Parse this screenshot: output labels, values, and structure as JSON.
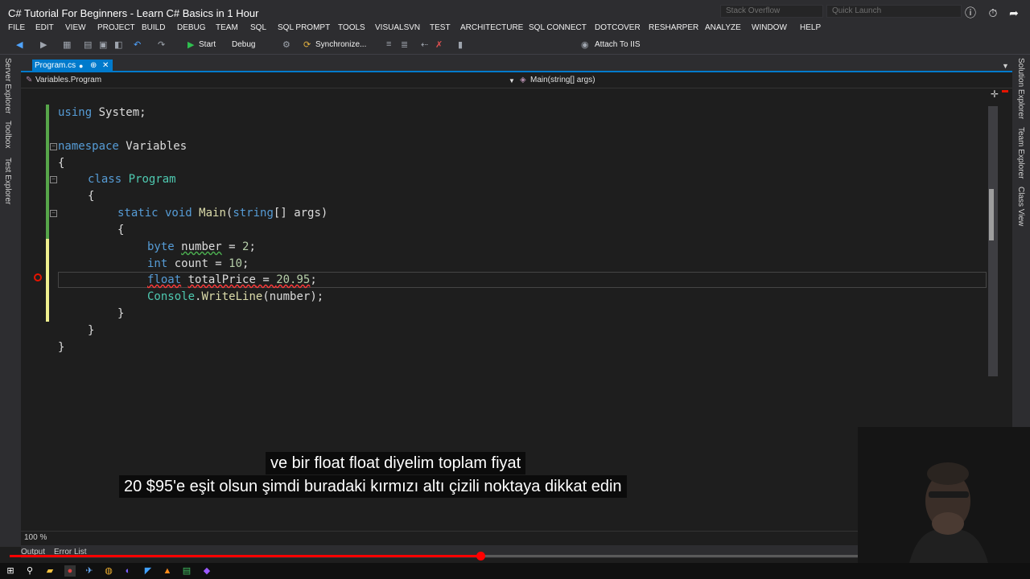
{
  "video_title": "C# Tutorial For Beginners - Learn C# Basics in 1 Hour",
  "search": {
    "stack_overflow": "Stack Overflow",
    "quick_launch": "Quick Launch"
  },
  "menu": [
    "FILE",
    "EDIT",
    "VIEW",
    "PROJECT",
    "BUILD",
    "DEBUG",
    "TEAM",
    "SQL",
    "SQL PROMPT",
    "TOOLS",
    "VISUALSVN",
    "TEST",
    "ARCHITECTURE",
    "SQL CONNECT",
    "DOTCOVER",
    "RESHARPER",
    "ANALYZE",
    "WINDOW",
    "HELP"
  ],
  "toolbar": {
    "start": "Start",
    "config": "Debug",
    "synchronize": "Synchronize...",
    "attach": "Attach To IIS"
  },
  "tab": {
    "label": "Program.cs",
    "pin": "⊕",
    "close": "✕"
  },
  "nav": {
    "left": "Variables.Program",
    "right": "Main(string[] args)"
  },
  "left_dock": [
    "Server Explorer",
    "Toolbox",
    "Test Explorer"
  ],
  "right_dock": [
    "Solution Explorer",
    "Team Explorer",
    "Class View"
  ],
  "code": {
    "l1_using": "using",
    "l1_system": " System;",
    "l3_namespace": "namespace",
    "l3_name": " Variables",
    "l4": "{",
    "l5_class": "class",
    "l5_name": " Program",
    "l6": "{",
    "l7_static": "static",
    "l7_void": " void",
    "l7_main": " Main",
    "l7_open": "(",
    "l7_string": "string",
    "l7_args": "[] args)",
    "l8": "{",
    "l9_byte": "byte",
    "l9_number": "number",
    "l9_eq": " = ",
    "l9_val": "2",
    "l9_end": ";",
    "l10_int": "int",
    "l10_rest": " count = ",
    "l10_val": "10",
    "l10_end": ";",
    "l11_float": "float",
    "l11_var": "totalPrice",
    "l11_eq": " = ",
    "l11_val": "20.95",
    "l11_end": ";",
    "l12_console": "Console",
    "l12_dot": ".",
    "l12_wl": "WriteLine",
    "l12_rest": "(number);",
    "l13": "}",
    "l14": "}",
    "l15": "}"
  },
  "subtitles": {
    "line1": "ve bir float float diyelim toplam fiyat",
    "line2": "20 $95'e eşit olsun şimdi buradaki kırmızı altı çizili noktaya dikkat edin"
  },
  "zoom": "100 %",
  "panel_tabs": {
    "output": "Output",
    "error_list": "Error List"
  },
  "video_progress": 0.555,
  "icons": {
    "info": "ⓘ",
    "clock": "⏱",
    "share": "➦",
    "play": "▶",
    "search": "⚲"
  },
  "colors": {
    "accent": "#007acc",
    "progress": "#ff0000",
    "keyword": "#569cd6",
    "type": "#4ec9b0"
  }
}
